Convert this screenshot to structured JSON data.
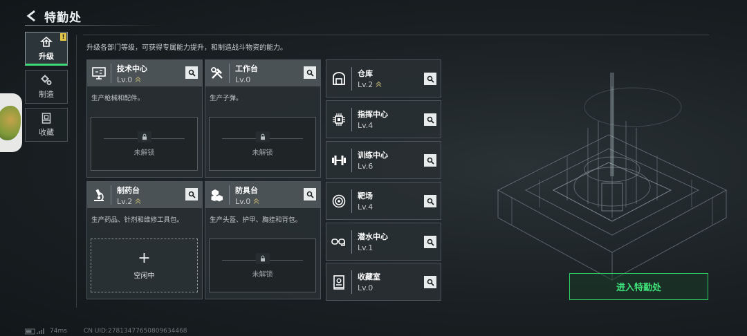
{
  "header": {
    "title": "特勤处"
  },
  "side_tabs": [
    {
      "label": "升级",
      "badge": "!",
      "active": true,
      "icon": "arrow-up-house-icon"
    },
    {
      "label": "制造",
      "active": false,
      "icon": "gears-icon"
    },
    {
      "label": "收藏",
      "active": false,
      "icon": "display-case-icon"
    }
  ],
  "subtitle": "升级各部门等级，可获得专属能力提升，和制造战斗物资的能力。",
  "cards": [
    {
      "name": "技术中心",
      "level": "Lv.0",
      "upgradable": true,
      "desc": "生产枪械和配件。",
      "slot": "未解锁",
      "icon": "monitor-icon"
    },
    {
      "name": "工作台",
      "level": "Lv.0",
      "upgradable": false,
      "desc": "生产子弹。",
      "slot": "未解锁",
      "icon": "tools-icon"
    },
    {
      "name": "制药台",
      "level": "Lv.2",
      "upgradable": true,
      "desc": "生产药品、针剂和维修工具包。",
      "slot": "空闲中",
      "slot_plus": "+",
      "icon": "microscope-icon"
    },
    {
      "name": "防具台",
      "level": "Lv.0",
      "upgradable": true,
      "desc": "生产头盔、护甲、胸挂和背包。",
      "slot": "未解锁",
      "icon": "armor-boxes-icon"
    }
  ],
  "rows": [
    {
      "name": "仓库",
      "level": "Lv.2",
      "upgradable": true,
      "icon": "warehouse-icon"
    },
    {
      "name": "指挥中心",
      "level": "Lv.4",
      "upgradable": false,
      "icon": "chip-icon"
    },
    {
      "name": "训练中心",
      "level": "Lv.6",
      "upgradable": false,
      "icon": "dumbbell-icon"
    },
    {
      "name": "靶场",
      "level": "Lv.4",
      "upgradable": false,
      "icon": "target-icon"
    },
    {
      "name": "潜水中心",
      "level": "Lv.1",
      "upgradable": false,
      "icon": "diving-mask-icon"
    },
    {
      "name": "收藏室",
      "level": "Lv.0",
      "upgradable": false,
      "icon": "trophy-case-icon"
    }
  ],
  "enter_button": "进入特勤处",
  "status": {
    "ping": "74ms",
    "uid": "CN UID:2781347765080963446​8"
  },
  "colors": {
    "accent_green": "#3fe57b",
    "card_header": "#4a5256",
    "badge_yellow": "#e1c64a"
  }
}
